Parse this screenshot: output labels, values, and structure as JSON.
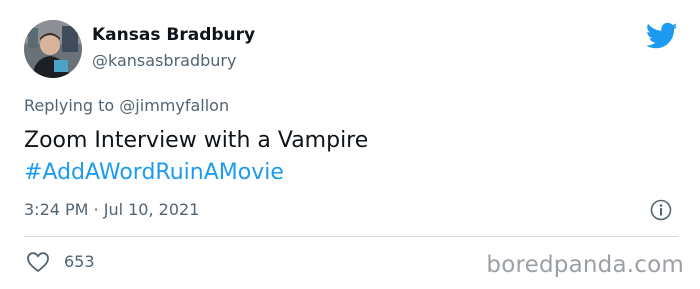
{
  "author": {
    "display_name": "Kansas Bradbury",
    "handle": "@kansasbradbury"
  },
  "icons": {
    "brand": "twitter-bird-icon",
    "info": "info-icon",
    "like": "heart-icon"
  },
  "colors": {
    "link": "#1d9bf0",
    "secondary_text": "#536471",
    "twitter_blue": "#1d9bf0"
  },
  "reply": {
    "prefix": "Replying to",
    "mention": "@jimmyfallon"
  },
  "tweet": {
    "text": "Zoom Interview with a Vampire",
    "hashtag": "#AddAWordRuinAMovie",
    "timestamp": "3:24 PM · Jul 10, 2021"
  },
  "stats": {
    "likes": "653"
  },
  "watermark": "boredpanda.com"
}
